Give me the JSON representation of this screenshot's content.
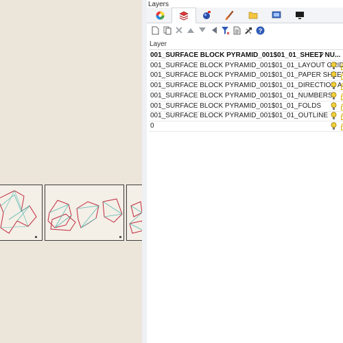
{
  "panel": {
    "title": "Layers",
    "tabs": [
      {
        "name": "color-wheel-icon"
      },
      {
        "name": "layer-stack-icon"
      },
      {
        "name": "material-ball-icon"
      },
      {
        "name": "brush-icon"
      },
      {
        "name": "folder-icon"
      },
      {
        "name": "display-icon"
      },
      {
        "name": "monitor-icon"
      }
    ],
    "toolbar_icons": [
      "new-layer-icon",
      "copy-layer-icon",
      "delete-icon",
      "move-up-icon",
      "move-down-icon",
      "move-left-icon",
      "filter-icon",
      "properties-icon",
      "tools-icon",
      "help-icon"
    ],
    "column_header": "Layer",
    "layers": [
      {
        "name": "001_SURFACE BLOCK PYRAMID_001$01_01_SHEET NU...",
        "current": true
      },
      {
        "name": "001_SURFACE BLOCK PYRAMID_001$01_01_LAYOUT GRID",
        "current": false
      },
      {
        "name": "001_SURFACE BLOCK PYRAMID_001$01_01_PAPER SHEET ...",
        "current": false
      },
      {
        "name": "001_SURFACE BLOCK PYRAMID_001$01_01_DIRECTION A...",
        "current": false
      },
      {
        "name": "001_SURFACE BLOCK PYRAMID_001$01_01_NUMBERS",
        "current": false
      },
      {
        "name": "001_SURFACE BLOCK PYRAMID_001$01_01_FOLDS",
        "current": false
      },
      {
        "name": "001_SURFACE BLOCK PYRAMID_001$01_01_OUTLINE",
        "current": false
      },
      {
        "name": "0",
        "current": false
      }
    ],
    "current_marker": "✓"
  },
  "colors": {
    "viewport_bg": "#ece5da",
    "cut_line": "#c0283c",
    "fold_line": "#58b9b0",
    "bulb": "#f0cf3a",
    "lock_gold": "#d8b000"
  }
}
